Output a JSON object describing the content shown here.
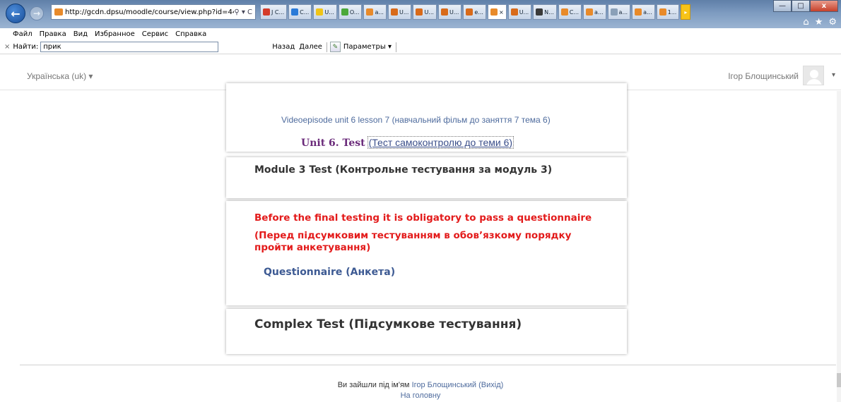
{
  "browser": {
    "url": "http://gcdn.dpsu/moodle/course/view.php?id=44",
    "addr_icons": "⚲ ▾ C",
    "tabs": [
      {
        "label": "J C...",
        "color": "#d43b2a"
      },
      {
        "label": "C...",
        "color": "#2a7ad8"
      },
      {
        "label": "U...",
        "color": "#f0c418"
      },
      {
        "label": "O...",
        "color": "#4aa83a"
      },
      {
        "label": "a...",
        "color": "#e88a2a"
      },
      {
        "label": "U...",
        "color": "#d86a1a"
      },
      {
        "label": "U...",
        "color": "#d86a1a"
      },
      {
        "label": "U...",
        "color": "#d86a1a"
      },
      {
        "label": "e...",
        "color": "#d86a1a"
      },
      {
        "label": "×",
        "color": "#e88a2a"
      },
      {
        "label": "U...",
        "color": "#d86a1a"
      },
      {
        "label": "N...",
        "color": "#3a3a3a"
      },
      {
        "label": "C...",
        "color": "#e88a2a"
      },
      {
        "label": "a...",
        "color": "#e88a2a"
      },
      {
        "label": "a...",
        "color": "#8aa0b8"
      },
      {
        "label": "a...",
        "color": "#e88a2a"
      },
      {
        "label": "1...",
        "color": "#e88a2a"
      }
    ],
    "win_min": "—",
    "win_max": "□",
    "win_close": "x",
    "home_glyph": "⌂",
    "fav_glyph": "★",
    "tools_glyph": "⚙",
    "menu": [
      "Файл",
      "Правка",
      "Вид",
      "Избранное",
      "Сервис",
      "Справка"
    ],
    "find": {
      "close": "×",
      "label": "Найти:",
      "value": "прик",
      "back": "Назад",
      "next": "Далее",
      "params": "Параметры ▾"
    }
  },
  "header": {
    "language": "Українська (uk) ▾",
    "user": "Ігор Блощинський",
    "caret": "▾"
  },
  "sections": {
    "unit6": {
      "video_link": "Videoepisode unit 6 lesson 7 (навчальний фільм до заняття 7 тема 6)",
      "test_strong": "Unit 6. Test",
      "test_link": "(Тест самоконтролю до теми 6)"
    },
    "module3": {
      "title": "Module 3 Test (Контрольне тестування за модуль 3)"
    },
    "questionnaire": {
      "notice_en": "Before the final testing it is obligatory to pass a questionnaire",
      "notice_uk": "(Перед підсумковим тестуванням в обов’язкому порядку пройти анкетування)",
      "link": "Questionnaire (Анкета)"
    },
    "complex": {
      "title": "Complex Test (Підсумкове тестування)"
    }
  },
  "footer": {
    "logged_in_prefix": "Ви зайшли під ім'ям",
    "user_link": "Ігор Блощинський",
    "logout": "(Вихід)",
    "home": "На головну"
  }
}
